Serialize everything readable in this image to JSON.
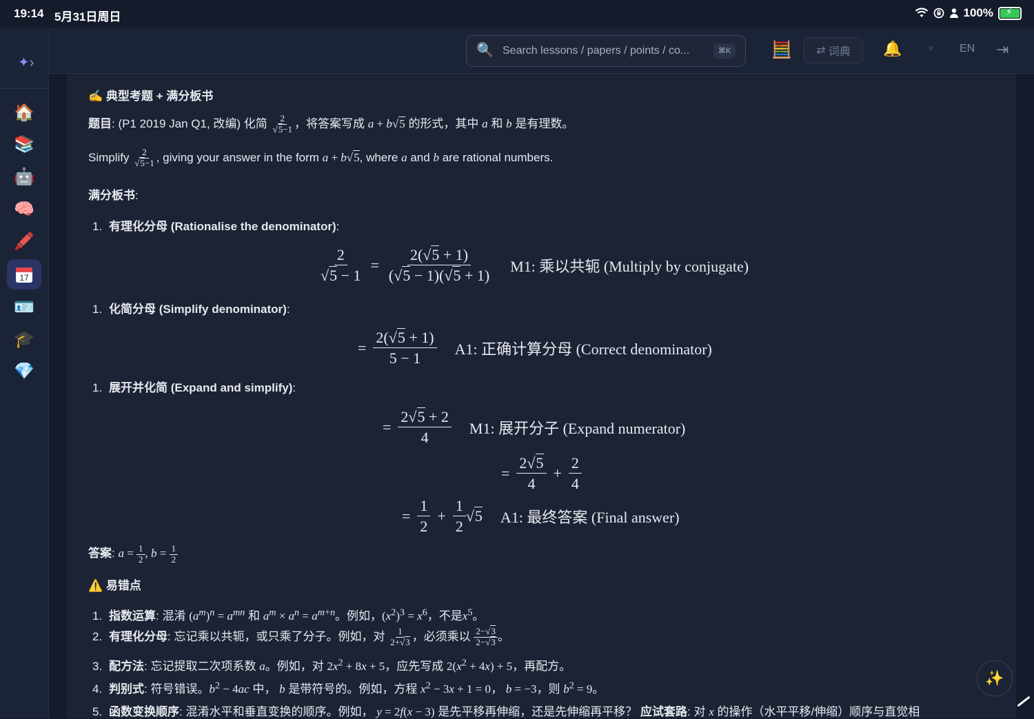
{
  "status": {
    "time": "19:14",
    "date": "5月31日周日",
    "battery": "100%"
  },
  "sidebar": {
    "icons": [
      "sparkle-arrow-icon",
      "home-icon",
      "books-icon",
      "robot-icon",
      "brain-icon",
      "pencil-icon",
      "calendar-icon",
      "id-card-icon",
      "graduation-cap-icon",
      "gem-icon"
    ],
    "calendar_day": "17"
  },
  "header": {
    "search_placeholder": "Search lessons / papers / points / co...",
    "shortcut": "⌘K",
    "dict_label": "词典",
    "lang": "EN"
  },
  "content": {
    "section_title": "典型考题 + 满分板书",
    "q_cn": {
      "label": "题目",
      "pre": ": (P1 2019 Jan Q1, 改编) 化简",
      "mid": "，将答案写成",
      "post1": "的形式，其中",
      "and": "和",
      "post2": "是有理数。"
    },
    "q_en": {
      "pre": "Simplify",
      "mid": ", giving your answer in the form",
      "post": ", where",
      "and": "and",
      "end": "are rational numbers."
    },
    "board_label": "满分板书",
    "steps": [
      {
        "num": "1.",
        "title": "有理化分母 (Rationalise the denominator)",
        "note": "M1: 乘以共轭 (Multiply by conjugate)"
      },
      {
        "num": "1.",
        "title": "化简分母 (Simplify denominator)",
        "note": "A1: 正确计算分母 (Correct denominator)"
      },
      {
        "num": "1.",
        "title": "展开并化简 (Expand and simplify)",
        "note1": "M1: 展开分子 (Expand numerator)",
        "note2": "A1: 最终答案 (Final answer)"
      }
    ],
    "answer_label": "答案",
    "mistakes_title": "易错点",
    "mistakes": [
      {
        "num": "1.",
        "label": "指数运算",
        "t1": ": 混淆",
        "t2": "和",
        "t3": "。例如，",
        "t4": "，不是",
        "t5": "。"
      },
      {
        "num": "2.",
        "label": "有理化分母",
        "t1": ": 忘记乘以共轭，或只乘了分子。例如，对",
        "t2": "，必须乘以",
        "t3": "。"
      },
      {
        "num": "3.",
        "label": "配方法",
        "t1": ": 忘记提取二次项系数",
        "t2": "。例如，对",
        "t3": "，应先写成",
        "t4": "，再配方。"
      },
      {
        "num": "4.",
        "label": "判别式",
        "t1": ": 符号错误。",
        "t2": "中，",
        "t3": "是带符号的。例如，方程",
        "t4": "，",
        "t5": "，则",
        "t6": "。"
      },
      {
        "num": "5.",
        "label": "函数变换顺序",
        "t1": ": 混淆水平和垂直变换的顺序。例如，",
        "t2": "是先平移再伸缩，还是先伸缩再平移？",
        "label2": "应试套路",
        "t3": ": 对",
        "t4": "的操作（水平平移/伸缩）顺序与直觉相"
      }
    ]
  }
}
